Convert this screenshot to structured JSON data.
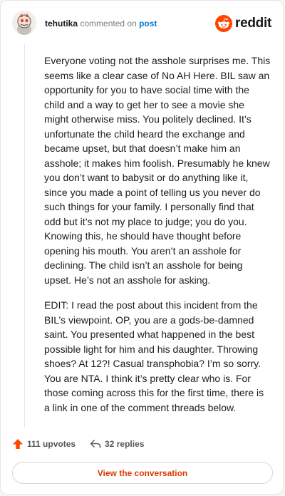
{
  "header": {
    "username": "tehutika",
    "action": "commented on",
    "post_link": "post",
    "brand": "reddit"
  },
  "comment": {
    "paragraphs": [
      "Everyone voting not the asshole surprises me. This seems like a clear case of No AH Here. BIL saw an opportunity for you to have social time with the child and a way to get her to see a movie she might otherwise miss. You politely declined. It’s unfortunate the child heard the exchange and became upset, but that doesn’t make him an asshole; it makes him foolish. Presumably he knew you don’t want to babysit or do anything like it, since you made a point of telling us you never do such things for your family. I personally find that odd but it’s not my place to judge; you do you. Knowing this, he should have thought before opening his mouth. You aren’t an asshole for declining. The child isn’t an asshole for being upset. He’s not an asshole for asking.",
      "EDIT: I read the post about this incident from the BIL’s viewpoint. OP, you are a gods-be-damned saint. You presented what happened in the best possible light for him and his daughter. Throwing shoes? At 12?! Casual transphobia? I’m so sorry. You are NTA. I think it’s pretty clear who is. For those coming across this for the first time, there is a link in one of the comment threads below."
    ]
  },
  "footer": {
    "upvotes": "111 upvotes",
    "replies": "32 replies",
    "view_button": "View the conversation"
  },
  "colors": {
    "brand_orange": "#ff4500",
    "link_blue": "#0079d3",
    "button_text": "#d93a00"
  },
  "icons": {
    "avatar": "avatar-icon",
    "logo": "reddit-logo-icon",
    "upvote": "upvote-arrow-icon",
    "reply": "reply-arrow-icon"
  }
}
